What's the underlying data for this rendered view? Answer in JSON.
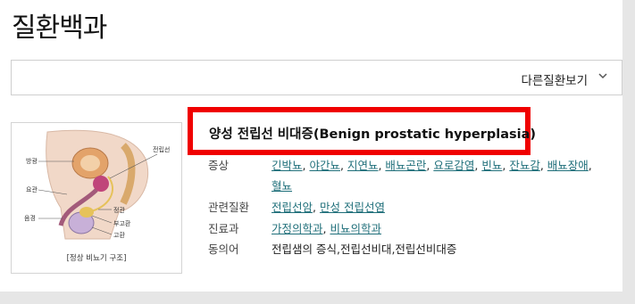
{
  "page": {
    "title": "질환백과"
  },
  "selector": {
    "label": "다른질환보기",
    "icon": "chevron-down-icon"
  },
  "thumbnail": {
    "caption": "[정상 비뇨기 구조]",
    "labels": {
      "bladder": "방광",
      "prostate": "전립선",
      "urethra": "요관",
      "penis": "음경",
      "vas": "정관",
      "epididymis": "부고환",
      "testis": "고환"
    }
  },
  "disease": {
    "title": "양성 전립선 비대증(Benign prostatic hyperplasia)"
  },
  "info": {
    "symptoms_label": "증상",
    "symptoms": [
      "긴박뇨",
      "야간뇨",
      "지연뇨",
      "배뇨곤란",
      "요로감염",
      "빈뇨",
      "잔뇨감",
      "배뇨장애",
      "혈뇨"
    ],
    "related_label": "관련질환",
    "related": [
      "전립선암",
      "만성 전립선염"
    ],
    "dept_label": "진료과",
    "dept": [
      "가정의학과",
      "비뇨의학과"
    ],
    "synonym_label": "동의어",
    "synonym": "전립샘의 증식,전립선비대,전립선비대증"
  },
  "colors": {
    "highlight": "#f00000",
    "link": "#1f6f7a"
  }
}
